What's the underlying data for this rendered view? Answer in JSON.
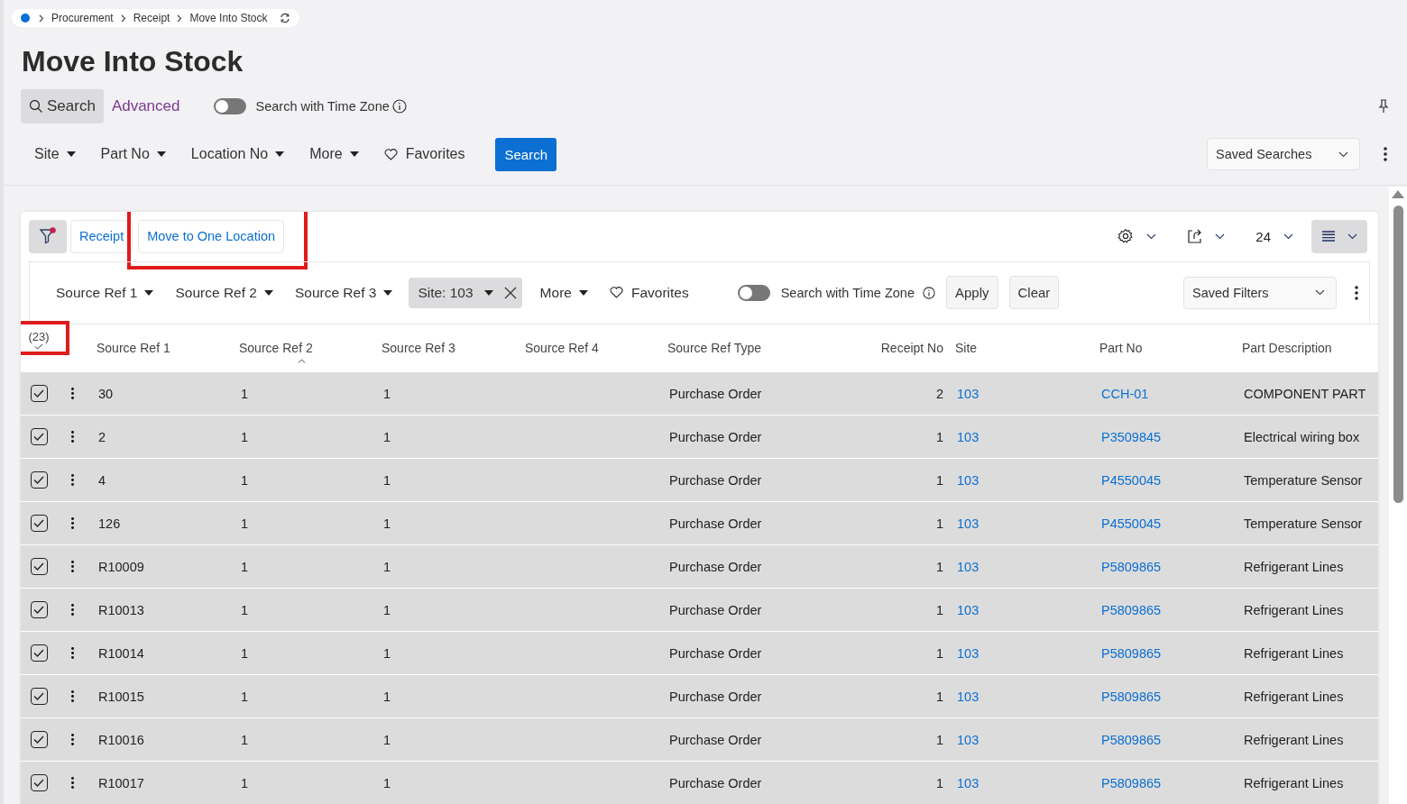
{
  "breadcrumb": [
    "Procurement",
    "Receipt",
    "Move Into Stock"
  ],
  "page_title": "Move Into Stock",
  "search_tabs": [
    {
      "label": "Search",
      "selected": true
    },
    {
      "label": "Advanced",
      "selected": false
    }
  ],
  "time_zone_toggle": {
    "label": "Search with Time Zone",
    "on": false
  },
  "search_filters": [
    "Site",
    "Part No",
    "Location No",
    "More"
  ],
  "favorites": "Favorites",
  "search_button": "Search",
  "saved_searches": "Saved Searches",
  "actions": [
    {
      "label": "Receipt",
      "highlighted": false
    },
    {
      "label": "Move to One Location",
      "highlighted": true
    }
  ],
  "filter_active": true,
  "page_size": "24",
  "filter_bar": {
    "filters": [
      {
        "label": "Source Ref 1",
        "kind": "dropdown"
      },
      {
        "label": "Source Ref 2",
        "kind": "dropdown"
      },
      {
        "label": "Source Ref 3",
        "kind": "dropdown"
      },
      {
        "label": "Site: 103",
        "kind": "applied"
      },
      {
        "label": "More",
        "kind": "dropdown"
      }
    ],
    "favorites": "Favorites",
    "time_zone_toggle": {
      "label": "Search with Time Zone",
      "on": false
    },
    "apply": "Apply",
    "clear": "Clear",
    "saved_filters": "Saved Filters"
  },
  "table": {
    "selection_count": "(23)",
    "selection_count_highlighted": true,
    "columns": [
      {
        "label": "Source Ref 1",
        "kind": "text"
      },
      {
        "label": "Source Ref 2",
        "kind": "text",
        "sorted": true
      },
      {
        "label": "Source Ref 3",
        "kind": "text"
      },
      {
        "label": "Source Ref 4",
        "kind": "text"
      },
      {
        "label": "Source Ref Type",
        "kind": "text"
      },
      {
        "label": "Receipt No",
        "kind": "number"
      },
      {
        "label": "Site",
        "kind": "link"
      },
      {
        "label": "Part No",
        "kind": "link"
      },
      {
        "label": "Part Description",
        "kind": "text"
      }
    ],
    "rows": [
      {
        "selected": true,
        "cells": [
          "30",
          "1",
          "1",
          "",
          "Purchase Order",
          "2",
          "103",
          "CCH-01",
          "COMPONENT PART"
        ]
      },
      {
        "selected": true,
        "cells": [
          "2",
          "1",
          "1",
          "",
          "Purchase Order",
          "1",
          "103",
          "P3509845",
          "Electrical wiring box"
        ]
      },
      {
        "selected": true,
        "cells": [
          "4",
          "1",
          "1",
          "",
          "Purchase Order",
          "1",
          "103",
          "P4550045",
          "Temperature Sensor"
        ]
      },
      {
        "selected": true,
        "cells": [
          "126",
          "1",
          "1",
          "",
          "Purchase Order",
          "1",
          "103",
          "P4550045",
          "Temperature Sensor"
        ]
      },
      {
        "selected": true,
        "cells": [
          "R10009",
          "1",
          "1",
          "",
          "Purchase Order",
          "1",
          "103",
          "P5809865",
          "Refrigerant Lines"
        ]
      },
      {
        "selected": true,
        "cells": [
          "R10013",
          "1",
          "1",
          "",
          "Purchase Order",
          "1",
          "103",
          "P5809865",
          "Refrigerant Lines"
        ]
      },
      {
        "selected": true,
        "cells": [
          "R10014",
          "1",
          "1",
          "",
          "Purchase Order",
          "1",
          "103",
          "P5809865",
          "Refrigerant Lines"
        ]
      },
      {
        "selected": true,
        "cells": [
          "R10015",
          "1",
          "1",
          "",
          "Purchase Order",
          "1",
          "103",
          "P5809865",
          "Refrigerant Lines"
        ]
      },
      {
        "selected": true,
        "cells": [
          "R10016",
          "1",
          "1",
          "",
          "Purchase Order",
          "1",
          "103",
          "P5809865",
          "Refrigerant Lines"
        ]
      },
      {
        "selected": true,
        "cells": [
          "R10017",
          "1",
          "1",
          "",
          "Purchase Order",
          "1",
          "103",
          "P5809865",
          "Refrigerant Lines"
        ]
      }
    ]
  }
}
